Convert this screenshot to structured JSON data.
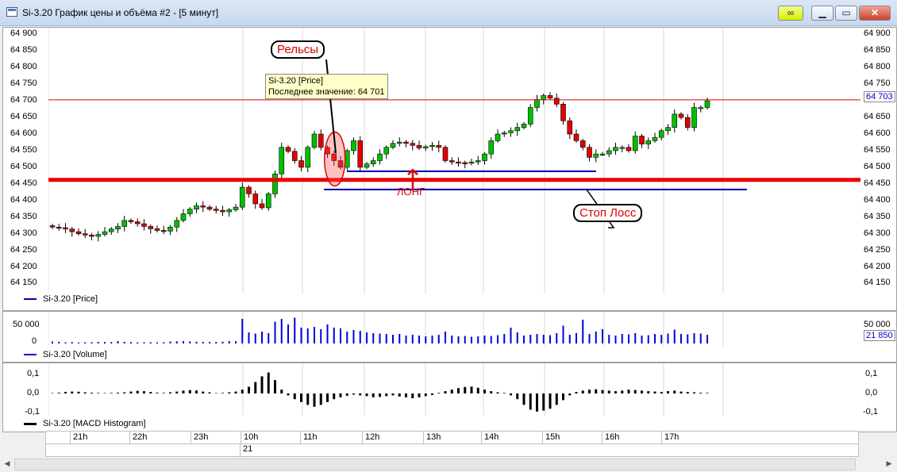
{
  "window": {
    "title": "Si-3.20 График цены и объёма #2 - [5 минут]"
  },
  "colors": {
    "up": "#00c000",
    "down": "#e00000",
    "volume": "#0000dd",
    "support": "#ee0000",
    "level": "#0000aa"
  },
  "price": {
    "ylim": [
      64120,
      64920
    ],
    "ticks": [
      "64 900",
      "64 850",
      "64 800",
      "64 750",
      "64 700",
      "64 650",
      "64 600",
      "64 550",
      "64 500",
      "64 450",
      "64 400",
      "64 350",
      "64 300",
      "64 250",
      "64 200",
      "64 150"
    ],
    "last_label": "64 703",
    "legend": "Si-3.20 [Price]",
    "tooltip": {
      "line1": "Si-3.20 [Price]",
      "line2": "Последнее значение: 64 701"
    },
    "annotations": {
      "rails": "Рельсы",
      "long": "ЛОНГ",
      "stop": "Стоп Лосс"
    },
    "levels": {
      "support": 64462,
      "entry": 64488,
      "stop": 64433
    }
  },
  "volume": {
    "ticks": [
      "50 000",
      "0"
    ],
    "last_label": "21 850",
    "legend": "Si-3.20 [Volume]"
  },
  "macd": {
    "ticks": [
      "0,1",
      "0,0",
      "-0,1"
    ],
    "legend": "Si-3.20 [MACD Histogram]"
  },
  "time_axis": {
    "hours": [
      "21h",
      "22h",
      "23h",
      "10h",
      "11h",
      "12h",
      "13h",
      "14h",
      "15h",
      "16h",
      "17h"
    ],
    "date": "21"
  },
  "chart_data": {
    "type": "candlestick",
    "close": [
      64320,
      64318,
      64314,
      64306,
      64300,
      64296,
      64292,
      64298,
      64306,
      64314,
      64322,
      64340,
      64336,
      64330,
      64322,
      64315,
      64310,
      64308,
      64320,
      64340,
      64360,
      64374,
      64384,
      64380,
      64374,
      64370,
      64366,
      64372,
      64380,
      64440,
      64420,
      64390,
      64378,
      64420,
      64480,
      64560,
      64548,
      64520,
      64500,
      64560,
      64600,
      64560,
      64540,
      64520,
      64500,
      64550,
      64580,
      64500,
      64510,
      64520,
      64540,
      64560,
      64572,
      64576,
      64572,
      64566,
      64558,
      64562,
      64566,
      64560,
      64520,
      64516,
      64514,
      64512,
      64516,
      64520,
      64540,
      64580,
      64600,
      64604,
      64610,
      64620,
      64630,
      64680,
      64704,
      64716,
      64708,
      64690,
      64640,
      64600,
      64580,
      64560,
      64530,
      64540,
      64540,
      64550,
      64560,
      64560,
      64550,
      64594,
      64570,
      64580,
      64590,
      64610,
      64620,
      64660,
      64650,
      64620,
      64680,
      64680,
      64700
    ],
    "volume": [
      5000,
      4000,
      3000,
      3500,
      2500,
      3000,
      3200,
      4000,
      3800,
      3500,
      6000,
      4000,
      3500,
      3000,
      3000,
      3200,
      2800,
      3000,
      5000,
      5500,
      6000,
      5000,
      4500,
      4000,
      4000,
      3800,
      4500,
      6000,
      5500,
      62000,
      28000,
      25000,
      30000,
      26000,
      55000,
      62000,
      48000,
      65000,
      40000,
      38000,
      42000,
      36000,
      48000,
      40000,
      38000,
      30000,
      34000,
      32000,
      28000,
      26000,
      25000,
      24000,
      22000,
      24000,
      20000,
      22000,
      20000,
      18000,
      20000,
      22000,
      30000,
      20000,
      18000,
      19000,
      17000,
      18000,
      20000,
      19000,
      21000,
      24000,
      40000,
      28000,
      20000,
      22000,
      24000,
      22000,
      21000,
      26000,
      45000,
      22000,
      26000,
      60000,
      24000,
      30000,
      36000,
      22000,
      20000,
      24000,
      23000,
      26000,
      20000,
      21000,
      24000,
      22000,
      25000,
      35000,
      24000,
      23000,
      26000,
      25000,
      21850
    ],
    "macd": [
      0.002,
      0.004,
      0.008,
      0.01,
      0.009,
      0.006,
      0.004,
      0.003,
      0.002,
      0.003,
      0.004,
      0.006,
      0.01,
      0.014,
      0.012,
      0.008,
      0.004,
      0.003,
      0.006,
      0.01,
      0.015,
      0.018,
      0.016,
      0.01,
      0.006,
      0.002,
      0.003,
      0.006,
      0.01,
      0.02,
      0.035,
      0.06,
      0.09,
      0.11,
      0.07,
      0.02,
      -0.01,
      -0.03,
      -0.045,
      -0.06,
      -0.07,
      -0.06,
      -0.045,
      -0.03,
      -0.02,
      -0.012,
      -0.006,
      -0.01,
      -0.014,
      -0.02,
      -0.018,
      -0.014,
      -0.01,
      -0.016,
      -0.02,
      -0.025,
      -0.02,
      -0.014,
      -0.008,
      0.003,
      0.012,
      0.02,
      0.028,
      0.034,
      0.036,
      0.03,
      0.02,
      0.012,
      0.006,
      0.003,
      -0.01,
      -0.03,
      -0.06,
      -0.085,
      -0.095,
      -0.09,
      -0.08,
      -0.06,
      -0.035,
      -0.01,
      0.008,
      0.015,
      0.02,
      0.022,
      0.018,
      0.015,
      0.012,
      0.015,
      0.02,
      0.018,
      0.015,
      0.012,
      0.01,
      0.008,
      0.012,
      0.015,
      0.01,
      0.008,
      0.006,
      0.004,
      0.003
    ]
  }
}
